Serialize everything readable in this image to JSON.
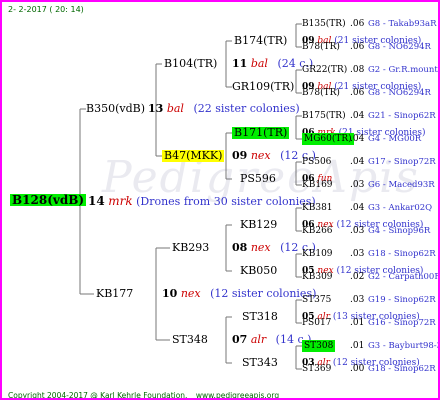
{
  "header": {
    "date": "2-  2-2017  ( 20: 14)"
  },
  "footer": {
    "copyright": "Copyright 2004-2017 @ Karl Kehrle Foundation.",
    "website": "www.pedigreeapis.org"
  },
  "root": {
    "name": "B128(vdB)"
  },
  "root_link": {
    "num": "14",
    "breed": "mrk",
    "note": "(Drones from 30 sister colonies)"
  },
  "gen1": [
    {
      "name": "B350(vdB)",
      "num": "13",
      "breed": "bal",
      "note": "(22 sister colonies)"
    },
    {
      "name": "KB177",
      "num": "10",
      "breed": "nex",
      "note": "(12 sister colonies)"
    }
  ],
  "gen2": [
    {
      "name": "B104(TR)",
      "num": "11",
      "breed": "bal",
      "note": "(24 c.)"
    },
    {
      "name": "B47(MKK)",
      "num": "09",
      "breed": "nex",
      "note": "(12 c.)"
    },
    {
      "name": "KB293",
      "num": "08",
      "breed": "nex",
      "note": "(12 c.)"
    },
    {
      "name": "ST348",
      "num": "07",
      "breed": "alr",
      "note": "(14 c.)"
    }
  ],
  "gen3": [
    {
      "name": "B174(TR)",
      "num": "09",
      "breed": "bal",
      "note": "(21 sister colonies)"
    },
    {
      "name": "GR109(TR)",
      "num": "09",
      "breed": "bal",
      "note": "(21 sister colonies)"
    },
    {
      "name": "B171(TR)",
      "num": "06",
      "breed": "mrk",
      "note": "(21 sister colonies)"
    },
    {
      "name": "PS596",
      "num": "06",
      "breed": "fun",
      "note": ""
    },
    {
      "name": "KB129",
      "num": "06",
      "breed": "nex",
      "note": "(12 sister colonies)"
    },
    {
      "name": "KB050",
      "num": "05",
      "breed": "nex",
      "note": "(12 sister colonies)"
    },
    {
      "name": "ST318",
      "num": "05",
      "breed": "alr",
      "note": "(13 sister colonies)"
    },
    {
      "name": "ST343",
      "num": "03",
      "breed": "alr",
      "note": "(12 sister colonies)"
    }
  ],
  "gen4": [
    {
      "name": "B135(TR)",
      "val": ".06",
      "loc": "G8 - Takab93aR"
    },
    {
      "name": "B78(TR)",
      "val": ".06",
      "loc": "G8 - NO6294R"
    },
    {
      "name": "GR22(TR)",
      "val": ".08",
      "loc": "G2 - Gr.R.mounta"
    },
    {
      "name": "B78(TR)",
      "val": ".06",
      "loc": "G8 - NO6294R"
    },
    {
      "name": "B175(TR)",
      "val": ".04",
      "loc": "G21 - Sinop62R"
    },
    {
      "name": "MG60(TR)",
      "val": ".04",
      "loc": "G4 - MG00R"
    },
    {
      "name": "PS506",
      "val": ".04",
      "loc": "G17 - Sinop72R"
    },
    {
      "name": "KB169",
      "val": ".03",
      "loc": "G6 - Maced93R"
    },
    {
      "name": "KB381",
      "val": ".04",
      "loc": "G3 - Ankar02Q"
    },
    {
      "name": "KB266",
      "val": ".03",
      "loc": "G4 - Sinop96R"
    },
    {
      "name": "KB109",
      "val": ".03",
      "loc": "G18 - Sinop62R"
    },
    {
      "name": "KB309",
      "val": ".02",
      "loc": "G2 - Carpath00R"
    },
    {
      "name": "ST375",
      "val": ".03",
      "loc": "G19 - Sinop62R"
    },
    {
      "name": "PS017",
      "val": ".01",
      "loc": "G16 - Sinop72R"
    },
    {
      "name": "ST308",
      "val": ".01",
      "loc": "G3 - Bayburt98-3"
    },
    {
      "name": "ST369",
      "val": ".00",
      "loc": "G18 - Sinop62R"
    }
  ],
  "colors": {
    "border": "#ff00ff",
    "highlight_green": "#00ee00",
    "highlight_yellow": "#ffff00",
    "breed": "#cc0000",
    "link": "#3333cc",
    "meta": "#006600"
  }
}
